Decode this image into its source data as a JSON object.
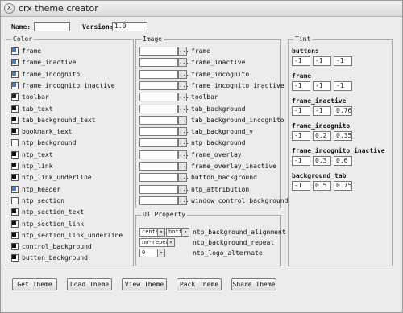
{
  "window": {
    "title": "crx theme creator",
    "close_glyph": "x"
  },
  "header": {
    "name_label": "Name:",
    "name_value": "",
    "version_label": "Version:",
    "version_value": "1.0"
  },
  "colors": {
    "legend": "Color",
    "items": [
      {
        "label": "frame",
        "color": "#4a7dbf"
      },
      {
        "label": "frame_inactive",
        "color": "#4a7dbf"
      },
      {
        "label": "frame_incognito",
        "color": "#4a7dbf"
      },
      {
        "label": "frame_incognito_inactive",
        "color": "#4a7dbf"
      },
      {
        "label": "toolbar",
        "color": "#222222"
      },
      {
        "label": "tab_text",
        "color": "#111111"
      },
      {
        "label": "tab_background_text",
        "color": "#111111"
      },
      {
        "label": "bookmark_text",
        "color": "#111111"
      },
      {
        "label": "ntp_background",
        "color": "#ffffff"
      },
      {
        "label": "ntp_text",
        "color": "#111111"
      },
      {
        "label": "ntp_link",
        "color": "#111111"
      },
      {
        "label": "ntp_link_underline",
        "color": "#111111"
      },
      {
        "label": "ntp_header",
        "color": "#4a7dbf"
      },
      {
        "label": "ntp_section",
        "color": "#ffffff"
      },
      {
        "label": "ntp_section_text",
        "color": "#111111"
      },
      {
        "label": "ntp_section_link",
        "color": "#111111"
      },
      {
        "label": "ntp_section_link_underline",
        "color": "#111111"
      },
      {
        "label": "control_background",
        "color": "#111111"
      },
      {
        "label": "button_background",
        "color": "#111111"
      }
    ]
  },
  "images": {
    "legend": "Image",
    "browse_glyph": "...",
    "items": [
      {
        "label": "frame"
      },
      {
        "label": "frame_inactive"
      },
      {
        "label": "frame_incognito"
      },
      {
        "label": "frame_incognito_inactive"
      },
      {
        "label": "toolbar"
      },
      {
        "label": "tab_background"
      },
      {
        "label": "tab_background_incognito"
      },
      {
        "label": "tab_background_v"
      },
      {
        "label": "ntp_background"
      },
      {
        "label": "frame_overlay"
      },
      {
        "label": "frame_overlay_inactive"
      },
      {
        "label": "button_background"
      },
      {
        "label": "ntp_attribution"
      },
      {
        "label": "window_control_background"
      }
    ]
  },
  "ui_property": {
    "legend": "UI Property",
    "rows": [
      {
        "selects": [
          "center",
          "bott"
        ],
        "label": "ntp_background_alignment"
      },
      {
        "selects": [
          "no-repeat"
        ],
        "label": "ntp_background_repeat"
      },
      {
        "selects": [
          "0"
        ],
        "label": "ntp_logo_alternate"
      }
    ]
  },
  "tint": {
    "legend": "Tint",
    "groups": [
      {
        "label": "buttons",
        "values": [
          "-1",
          "-1",
          "-1"
        ]
      },
      {
        "label": "frame",
        "values": [
          "-1",
          "-1",
          "-1"
        ]
      },
      {
        "label": "frame_inactive",
        "values": [
          "-1",
          "-1",
          "0.76"
        ]
      },
      {
        "label": "frame_incognito",
        "values": [
          "-1",
          "0.2",
          "0.35"
        ]
      },
      {
        "label": "frame_incognito_inactive",
        "values": [
          "-1",
          "0.3",
          "0.6"
        ]
      },
      {
        "label": "background_tab",
        "values": [
          "-1",
          "0.5",
          "0.75"
        ]
      }
    ]
  },
  "actions": [
    {
      "label": "Get Theme"
    },
    {
      "label": "Load Theme"
    },
    {
      "label": "View Theme"
    },
    {
      "label": "Pack Theme"
    },
    {
      "label": "Share Theme"
    }
  ]
}
